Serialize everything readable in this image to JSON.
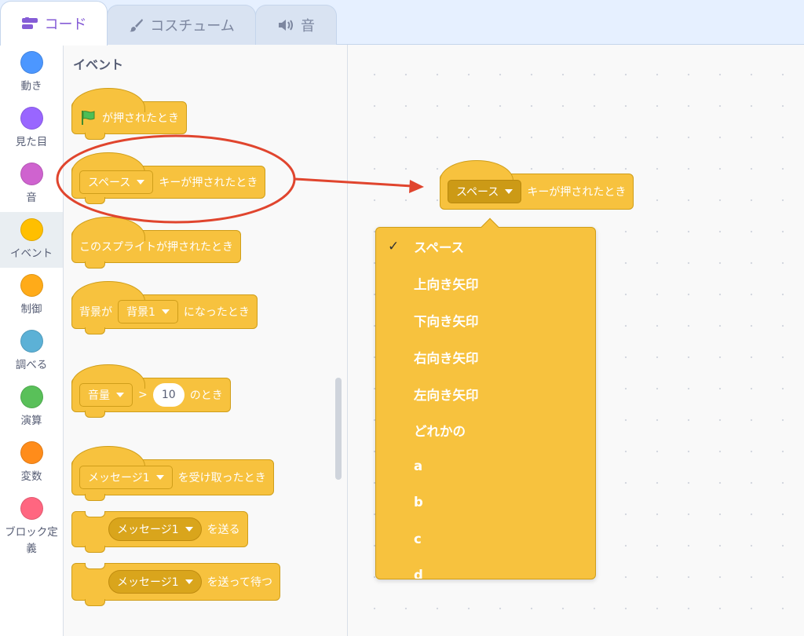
{
  "tabs": [
    {
      "label": "コード",
      "icon": "code-icon",
      "active": true
    },
    {
      "label": "コスチューム",
      "icon": "brush-icon",
      "active": false
    },
    {
      "label": "音",
      "icon": "speaker-icon",
      "active": false
    }
  ],
  "categories": [
    {
      "label": "動き",
      "color": "#4c97ff"
    },
    {
      "label": "見た目",
      "color": "#9966ff"
    },
    {
      "label": "音",
      "color": "#cf63cf"
    },
    {
      "label": "イベント",
      "color": "#ffbf00"
    },
    {
      "label": "制御",
      "color": "#ffab19"
    },
    {
      "label": "調べる",
      "color": "#5cb1d6"
    },
    {
      "label": "演算",
      "color": "#59c059"
    },
    {
      "label": "変数",
      "color": "#ff8c1a"
    },
    {
      "label": "ブロック定義",
      "color": "#ff6680"
    }
  ],
  "palette": {
    "title": "イベント",
    "flag_block": {
      "text": "が押されたとき"
    },
    "key_block": {
      "dropdown": "スペース",
      "text": "キーが押されたとき"
    },
    "sprite_block": {
      "text": "このスプライトが押されたとき"
    },
    "backdrop_block": {
      "prefix": "背景が",
      "dropdown": "背景1",
      "suffix": "になったとき"
    },
    "volume_block": {
      "dropdown": "音量",
      "operator": ">",
      "value": "10",
      "suffix": "のとき"
    },
    "receive_block": {
      "dropdown": "メッセージ1",
      "text": "を受け取ったとき"
    },
    "broadcast_block": {
      "dropdown": "メッセージ1",
      "text": "を送る"
    },
    "broadcast_wait_block": {
      "dropdown": "メッセージ1",
      "text": "を送って待つ"
    }
  },
  "workspace": {
    "key_block": {
      "dropdown": "スペース",
      "text": "キーが押されたとき"
    },
    "menu": {
      "check": "✓",
      "items": [
        "スペース",
        "上向き矢印",
        "下向き矢印",
        "右向き矢印",
        "左向き矢印",
        "どれかの",
        "a",
        "b",
        "c",
        "d"
      ],
      "selected_index": 0
    }
  },
  "colors": {
    "events": "#f7c23e",
    "annotation": "#e0452e",
    "accent": "#855cd6"
  }
}
